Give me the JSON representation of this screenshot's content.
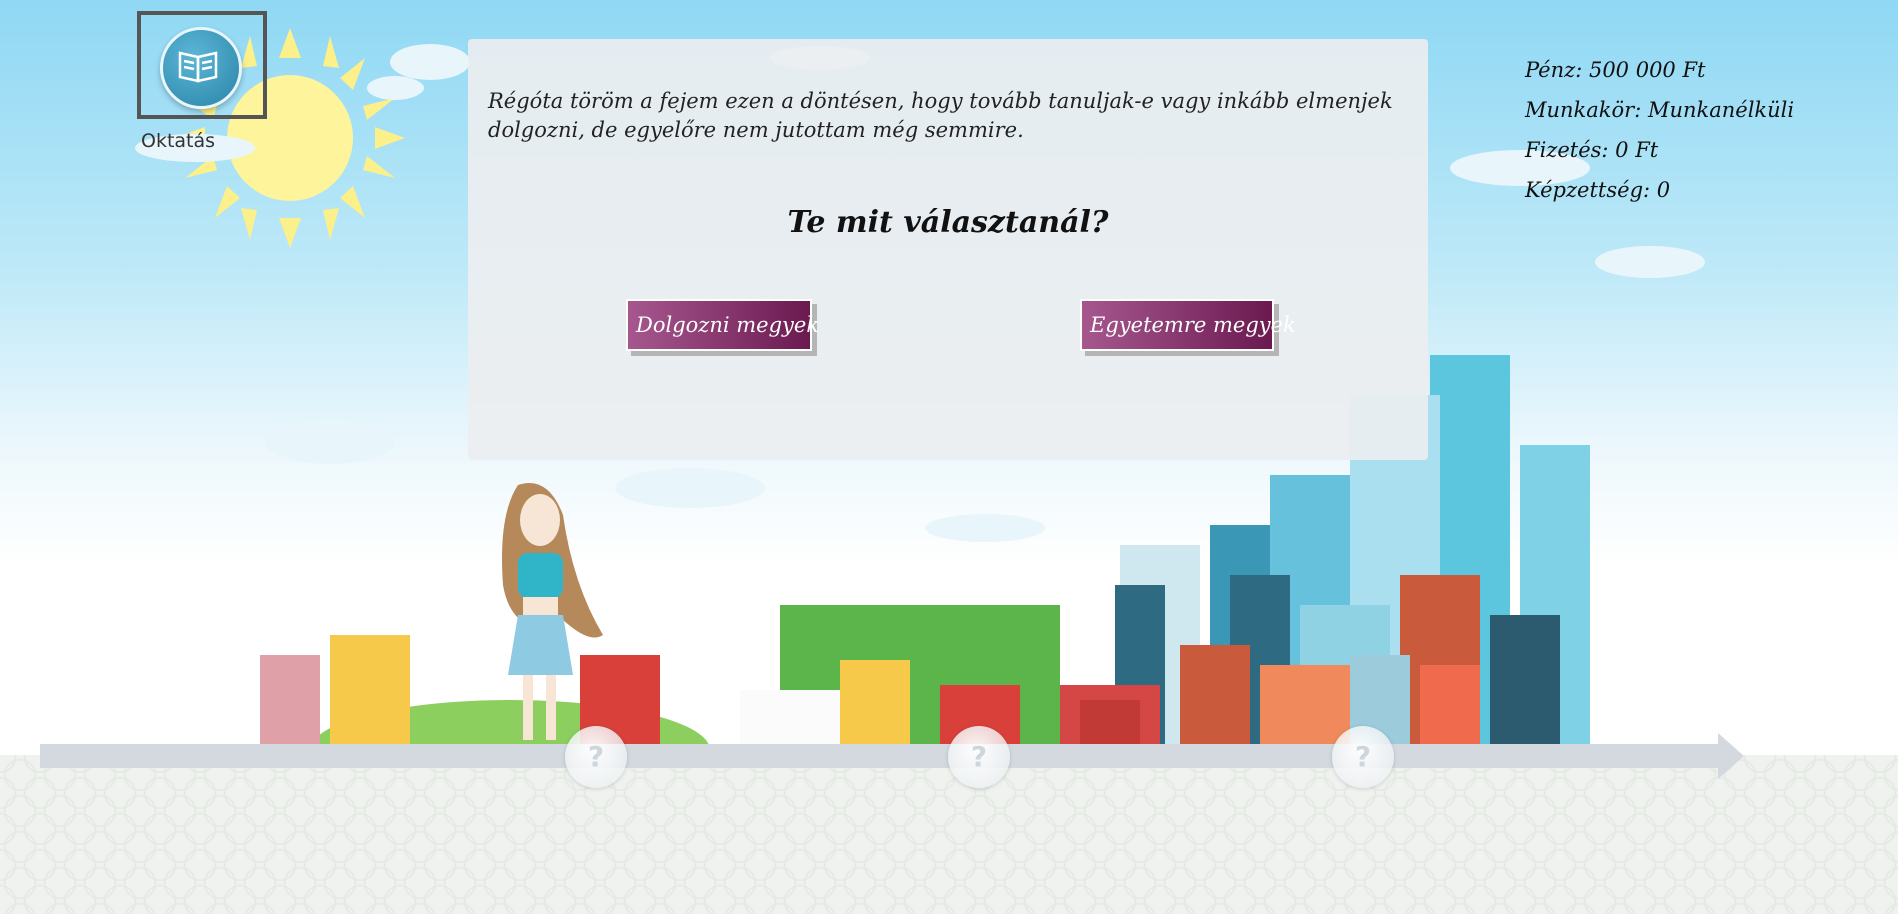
{
  "education": {
    "label": "Oktatás",
    "icon": "open-book-icon"
  },
  "panel": {
    "story": "Régóta töröm a fejem ezen a döntésen, hogy tovább tanuljak-e vagy inkább elmenjek dolgozni, de egyelőre nem jutottam még semmire.",
    "question": "Te mit választanál?",
    "choices": [
      {
        "label": "Dolgozni megyek"
      },
      {
        "label": "Egyetemre megyek"
      }
    ]
  },
  "stats": {
    "money": "Pénz: 500 000 Ft",
    "job": "Munkakör: Munkanélküli",
    "salary": "Fizetés: 0 Ft",
    "qualification": "Képzettség: 0"
  },
  "timeline": {
    "markers": [
      {
        "label": "?"
      },
      {
        "label": "?"
      },
      {
        "label": "?"
      }
    ]
  },
  "colors": {
    "button_gradient_start": "#a6588e",
    "button_gradient_end": "#6b1a50",
    "sky": "#8fd8f4"
  }
}
